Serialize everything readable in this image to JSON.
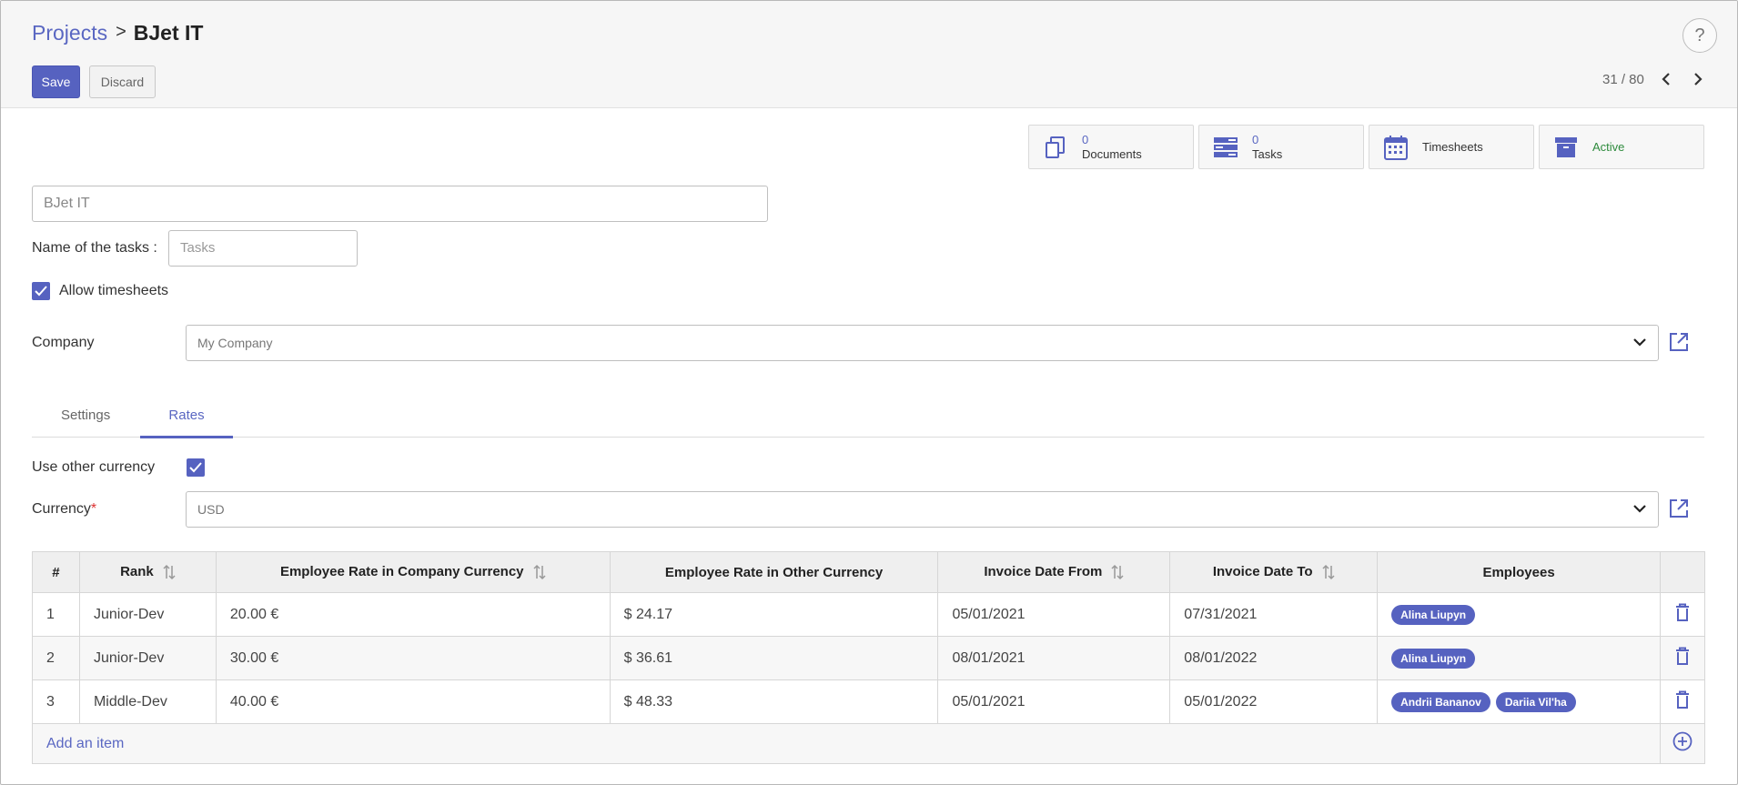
{
  "breadcrumb": {
    "parent": "Projects",
    "separator": ">",
    "current": "BJet IT"
  },
  "help": {
    "label": "?"
  },
  "toolbar": {
    "save_label": "Save",
    "discard_label": "Discard"
  },
  "pager": {
    "value": "31 / 80"
  },
  "stat_buttons": {
    "documents": {
      "count": "0",
      "label": "Documents"
    },
    "tasks": {
      "count": "0",
      "label": "Tasks"
    },
    "timesheets": {
      "label": "Timesheets"
    },
    "status": {
      "label": "Active"
    }
  },
  "form": {
    "project_name": "BJet IT",
    "tasks_label": "Name of the tasks :",
    "tasks_placeholder": "Tasks",
    "allow_timesheets_label": "Allow timesheets",
    "allow_timesheets": true,
    "company_label": "Company",
    "company_value": "My Company"
  },
  "tabs": [
    {
      "label": "Settings",
      "active": false
    },
    {
      "label": "Rates",
      "active": true
    }
  ],
  "rates": {
    "use_other_currency_label": "Use other currency",
    "use_other_currency": true,
    "currency_label": "Currency",
    "currency_required_mark": "*",
    "currency_value": "USD",
    "columns": [
      "#",
      "Rank",
      "Employee Rate in Company Currency",
      "Employee Rate in Other Currency",
      "Invoice Date From",
      "Invoice Date To",
      "Employees"
    ],
    "rows": [
      {
        "num": "1",
        "rank": "Junior-Dev",
        "rate_company": "20.00 €",
        "rate_other": "$ 24.17",
        "date_from": "05/01/2021",
        "date_to": "07/31/2021",
        "employees": [
          "Alina Liupyn"
        ]
      },
      {
        "num": "2",
        "rank": "Junior-Dev",
        "rate_company": "30.00 €",
        "rate_other": "$ 36.61",
        "date_from": "08/01/2021",
        "date_to": "08/01/2022",
        "employees": [
          "Alina Liupyn"
        ]
      },
      {
        "num": "3",
        "rank": "Middle-Dev",
        "rate_company": "40.00 €",
        "rate_other": "$ 48.33",
        "date_from": "05/01/2021",
        "date_to": "05/01/2022",
        "employees": [
          "Andrii Bananov",
          "Dariia Vil'ha"
        ]
      }
    ],
    "add_item_label": "Add an item"
  },
  "colors": {
    "accent": "#5662c0",
    "link": "#5a67c2",
    "active_status": "#2e8b3d"
  },
  "icons": [
    "help-icon",
    "chevron-left-icon",
    "chevron-right-icon",
    "documents-icon",
    "tasks-icon",
    "calendar-icon",
    "archive-icon",
    "checkmark-icon",
    "chevron-down-icon",
    "external-link-icon",
    "sort-icon",
    "trash-icon",
    "plus-circle-icon"
  ]
}
